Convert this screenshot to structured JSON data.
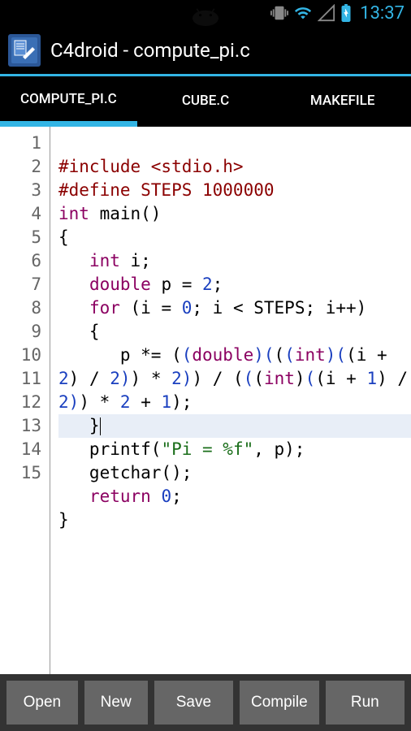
{
  "status": {
    "time": "13:37"
  },
  "header": {
    "title": "C4droid - compute_pi.c"
  },
  "tabs": [
    {
      "label": "COMPUTE_PI.C",
      "active": true
    },
    {
      "label": "CUBE.C",
      "active": false
    },
    {
      "label": "MAKEFILE",
      "active": false
    }
  ],
  "editor": {
    "line_count": 15,
    "highlighted_line": 11,
    "lines_raw": [
      "",
      "#include <stdio.h>",
      "#define STEPS 1000000",
      "int main()",
      "{",
      "   int i;",
      "   double p = 2;",
      "   for (i = 0; i < STEPS; i++)",
      "   {",
      "      p *= ((double)(((int)((i + 2) / 2)) * 2)) / (((int)((i + 1) / 2)) * 2 + 1);",
      "   }",
      "   printf(\"Pi = %f\", p);",
      "   getchar();",
      "   return 0;",
      "}"
    ]
  },
  "bottom_bar": [
    "Open",
    "New",
    "Save",
    "Compile",
    "Run"
  ],
  "colors": {
    "accent": "#33b5e5",
    "preprocessor": "#8b0000",
    "keyword": "#8b0061",
    "string": "#1a6e1a",
    "number": "#1a3fbf"
  }
}
